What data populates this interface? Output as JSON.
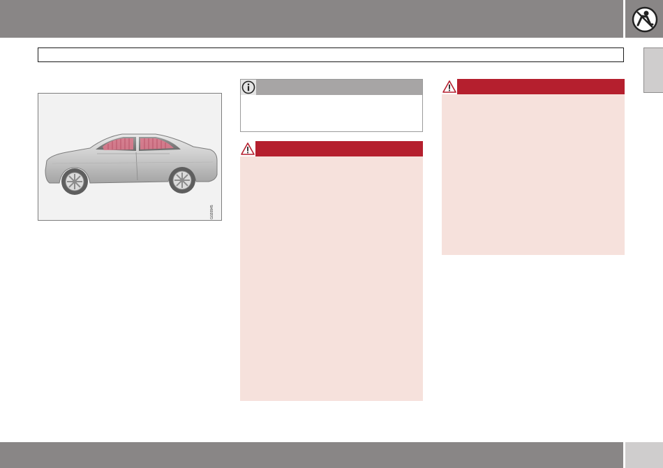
{
  "header": {
    "title": "",
    "chapter_icon": "seatbelt-airbag-icon"
  },
  "section_title": "",
  "figure": {
    "code": "G020945"
  },
  "note": {
    "icon": "info-icon",
    "text": ""
  },
  "warnings": [
    {
      "icon": "warning-triangle-icon",
      "text": ""
    },
    {
      "icon": "warning-triangle-icon",
      "text": ""
    }
  ],
  "footer": {
    "page_number": ""
  },
  "colors": {
    "header_gray": "#898686",
    "tab_light_gray": "#cfcdcd",
    "warning_red": "#b51f2e",
    "warning_background": "#f6e1dc",
    "note_gray": "#a7a5a5",
    "airbag_pink": "#e07a8e"
  }
}
